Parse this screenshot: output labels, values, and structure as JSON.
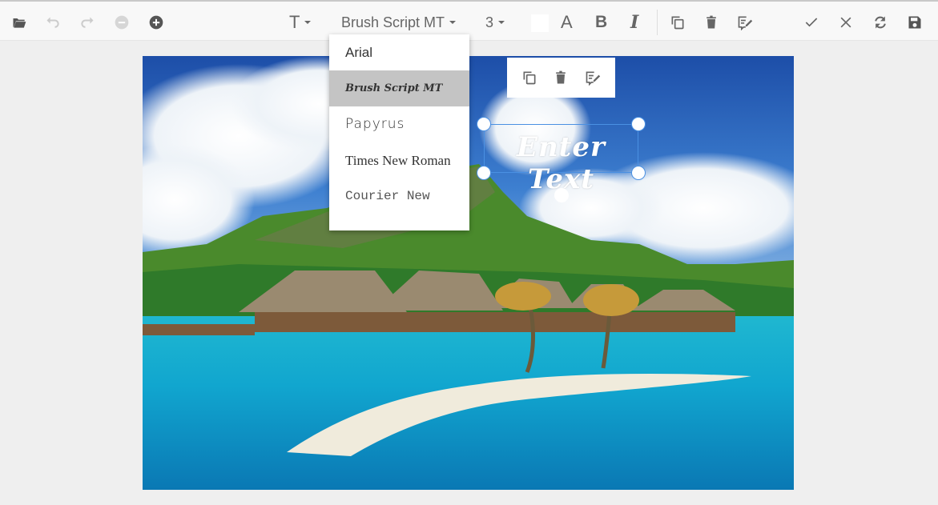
{
  "toolbar": {
    "left_icons": [
      "folder-open-icon",
      "undo-icon",
      "redo-icon",
      "zoom-out-icon",
      "zoom-in-icon"
    ],
    "text_tool_label": "T",
    "font_family": "Brush Script MT",
    "font_size": "3",
    "font_color": "#ffffff",
    "font_color_label": "A",
    "bold_label": "B",
    "italic_label": "I",
    "right_icons": [
      "copy-icon",
      "delete-icon",
      "edit-text-icon",
      "check-icon",
      "close-icon",
      "reset-icon",
      "save-icon"
    ]
  },
  "font_dropdown": {
    "options": [
      "Arial",
      "Brush Script MT",
      "Papyrus",
      "Times New Roman",
      "Courier New"
    ],
    "selected": "Brush Script MT"
  },
  "canvas": {
    "text_annotation": "Enter Text"
  },
  "quick_toolbar": {
    "icons": [
      "copy-icon",
      "delete-icon",
      "edit-text-icon"
    ]
  }
}
